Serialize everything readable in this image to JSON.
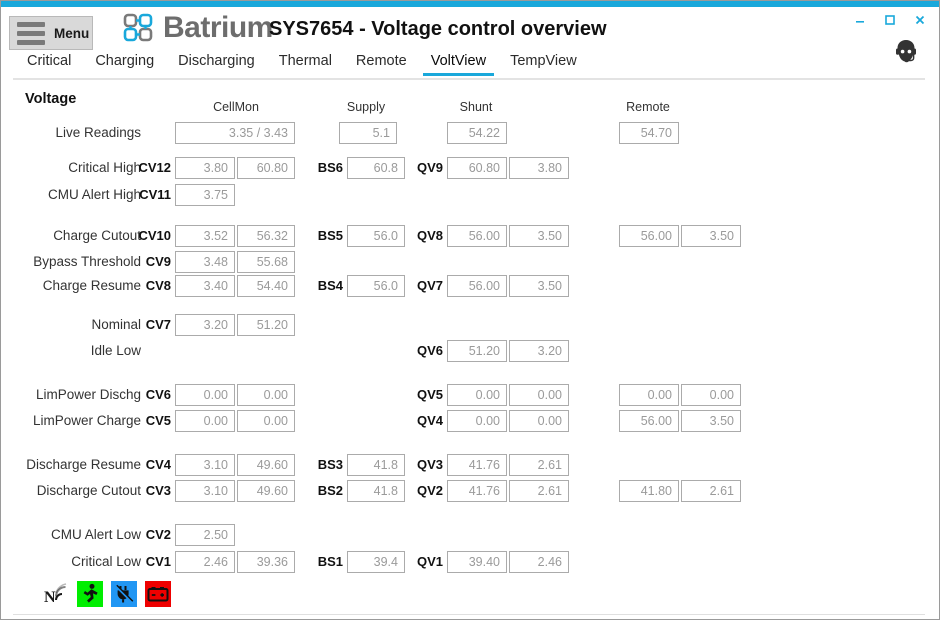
{
  "window": {
    "accent_color": "#19a8db",
    "controls": [
      {
        "name": "minimize",
        "glyph": "minimize-icon"
      },
      {
        "name": "maximize",
        "glyph": "maximize-icon"
      },
      {
        "name": "close",
        "glyph": "close-icon"
      }
    ]
  },
  "header": {
    "menu_label": "Menu",
    "brand": "Batrium",
    "title": "SYS7654 - Voltage control overview",
    "support_avatar": "headset-support-icon"
  },
  "tabs": [
    {
      "label": "Critical",
      "active": false
    },
    {
      "label": "Charging",
      "active": false
    },
    {
      "label": "Discharging",
      "active": false
    },
    {
      "label": "Thermal",
      "active": false
    },
    {
      "label": "Remote",
      "active": false
    },
    {
      "label": "VoltView",
      "active": true
    },
    {
      "label": "TempView",
      "active": false
    }
  ],
  "panel": {
    "section_title": "Voltage",
    "column_headers": {
      "cellmon": "CellMon",
      "supply": "Supply",
      "shunt": "Shunt",
      "remote": "Remote"
    },
    "rows": [
      {
        "label": "Live Readings",
        "cellmon_code": "",
        "cellmon_a": "3.35 / 3.43",
        "cellmon_b": "",
        "bs_code": "",
        "bs_val": "5.1",
        "qv_code": "",
        "qv_a": "54.22",
        "qv_b": "",
        "rem_a": "54.70",
        "rem_b": ""
      },
      {
        "label": "Critical High",
        "cellmon_code": "CV12",
        "cellmon_a": "3.80",
        "cellmon_b": "60.80",
        "bs_code": "BS6",
        "bs_val": "60.8",
        "qv_code": "QV9",
        "qv_a": "60.80",
        "qv_b": "3.80",
        "rem_a": "",
        "rem_b": ""
      },
      {
        "label": "CMU Alert High",
        "cellmon_code": "CV11",
        "cellmon_a": "3.75",
        "cellmon_b": "",
        "bs_code": "",
        "bs_val": "",
        "qv_code": "",
        "qv_a": "",
        "qv_b": "",
        "rem_a": "",
        "rem_b": ""
      },
      {
        "label": "Charge Cutout",
        "cellmon_code": "CV10",
        "cellmon_a": "3.52",
        "cellmon_b": "56.32",
        "bs_code": "BS5",
        "bs_val": "56.0",
        "qv_code": "QV8",
        "qv_a": "56.00",
        "qv_b": "3.50",
        "rem_a": "56.00",
        "rem_b": "3.50"
      },
      {
        "label": "Bypass  Threshold",
        "cellmon_code": "CV9",
        "cellmon_a": "3.48",
        "cellmon_b": "55.68",
        "bs_code": "",
        "bs_val": "",
        "qv_code": "",
        "qv_a": "",
        "qv_b": "",
        "rem_a": "",
        "rem_b": ""
      },
      {
        "label": "Charge Resume",
        "cellmon_code": "CV8",
        "cellmon_a": "3.40",
        "cellmon_b": "54.40",
        "bs_code": "BS4",
        "bs_val": "56.0",
        "qv_code": "QV7",
        "qv_a": "56.00",
        "qv_b": "3.50",
        "rem_a": "",
        "rem_b": ""
      },
      {
        "label": "Nominal",
        "cellmon_code": "CV7",
        "cellmon_a": "3.20",
        "cellmon_b": "51.20",
        "bs_code": "",
        "bs_val": "",
        "qv_code": "",
        "qv_a": "",
        "qv_b": "",
        "rem_a": "",
        "rem_b": ""
      },
      {
        "label": "Idle Low",
        "cellmon_code": "",
        "cellmon_a": "",
        "cellmon_b": "",
        "bs_code": "",
        "bs_val": "",
        "qv_code": "QV6",
        "qv_a": "51.20",
        "qv_b": "3.20",
        "rem_a": "",
        "rem_b": ""
      },
      {
        "label": "LimPower Dischg",
        "cellmon_code": "CV6",
        "cellmon_a": "0.00",
        "cellmon_b": "0.00",
        "bs_code": "",
        "bs_val": "",
        "qv_code": "QV5",
        "qv_a": "0.00",
        "qv_b": "0.00",
        "rem_a": "0.00",
        "rem_b": "0.00"
      },
      {
        "label": "LimPower Charge",
        "cellmon_code": "CV5",
        "cellmon_a": "0.00",
        "cellmon_b": "0.00",
        "bs_code": "",
        "bs_val": "",
        "qv_code": "QV4",
        "qv_a": "0.00",
        "qv_b": "0.00",
        "rem_a": "56.00",
        "rem_b": "3.50"
      },
      {
        "label": "Discharge Resume",
        "cellmon_code": "CV4",
        "cellmon_a": "3.10",
        "cellmon_b": "49.60",
        "bs_code": "BS3",
        "bs_val": "41.8",
        "qv_code": "QV3",
        "qv_a": "41.76",
        "qv_b": "2.61",
        "rem_a": "",
        "rem_b": ""
      },
      {
        "label": "Discharge Cutout",
        "cellmon_code": "CV3",
        "cellmon_a": "3.10",
        "cellmon_b": "49.60",
        "bs_code": "BS2",
        "bs_val": "41.8",
        "qv_code": "QV2",
        "qv_a": "41.76",
        "qv_b": "2.61",
        "rem_a": "41.80",
        "rem_b": "2.61"
      },
      {
        "label": "CMU Alert Low",
        "cellmon_code": "CV2",
        "cellmon_a": "2.50",
        "cellmon_b": "",
        "bs_code": "",
        "bs_val": "",
        "qv_code": "",
        "qv_a": "",
        "qv_b": "",
        "rem_a": "",
        "rem_b": ""
      },
      {
        "label": "Critical Low",
        "cellmon_code": "CV1",
        "cellmon_a": "2.46",
        "cellmon_b": "39.36",
        "bs_code": "BS1",
        "bs_val": "39.4",
        "qv_code": "QV1",
        "qv_a": "39.40",
        "qv_b": "2.46",
        "rem_a": "",
        "rem_b": ""
      }
    ]
  },
  "status_icons": [
    {
      "name": "network-signal-icon",
      "style": "plain",
      "color": "#222222"
    },
    {
      "name": "running-person-icon",
      "style": "green",
      "color": "#00ee00"
    },
    {
      "name": "power-plug-icon",
      "style": "blue",
      "color": "#2196f3"
    },
    {
      "name": "battery-icon",
      "style": "red",
      "color": "#ee0000"
    }
  ]
}
